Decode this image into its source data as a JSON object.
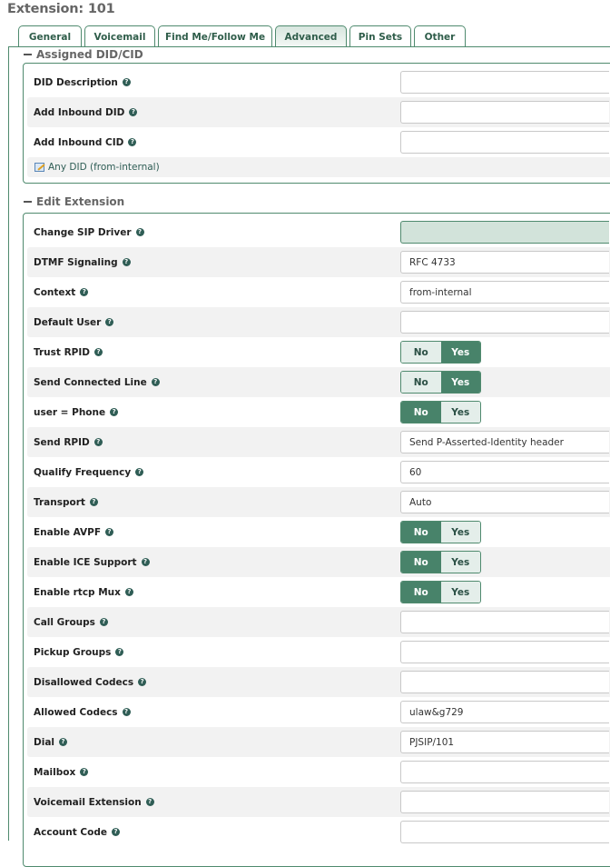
{
  "page": {
    "title": "Extension: 101"
  },
  "tabs": [
    {
      "label": "General",
      "active": false
    },
    {
      "label": "Voicemail",
      "active": false
    },
    {
      "label": "Find Me/Follow Me",
      "active": false
    },
    {
      "label": "Advanced",
      "active": true
    },
    {
      "label": "Pin Sets",
      "active": false
    },
    {
      "label": "Other",
      "active": false
    }
  ],
  "sections": {
    "assigned": {
      "title": "Assigned DID/CID",
      "rows": [
        {
          "label": "DID Description",
          "type": "input",
          "value": ""
        },
        {
          "label": "Add Inbound DID",
          "type": "input",
          "value": ""
        },
        {
          "label": "Add Inbound CID",
          "type": "input",
          "value": ""
        }
      ],
      "link": "Any DID (from-internal)"
    },
    "edit": {
      "title": "Edit Extension",
      "rows": [
        {
          "label": "Change SIP Driver",
          "type": "green",
          "value": ""
        },
        {
          "label": "DTMF Signaling",
          "type": "input",
          "value": "RFC 4733"
        },
        {
          "label": "Context",
          "type": "input",
          "value": "from-internal"
        },
        {
          "label": "Default User",
          "type": "input",
          "value": ""
        },
        {
          "label": "Trust RPID",
          "type": "toggle",
          "value": "Yes"
        },
        {
          "label": "Send Connected Line",
          "type": "toggle",
          "value": "Yes"
        },
        {
          "label": "user = Phone",
          "type": "toggle",
          "value": "No"
        },
        {
          "label": "Send RPID",
          "type": "input",
          "value": "Send P-Asserted-Identity header"
        },
        {
          "label": "Qualify Frequency",
          "type": "input",
          "value": "60"
        },
        {
          "label": "Transport",
          "type": "input",
          "value": "Auto"
        },
        {
          "label": "Enable AVPF",
          "type": "toggle",
          "value": "No"
        },
        {
          "label": "Enable ICE Support",
          "type": "toggle",
          "value": "No"
        },
        {
          "label": "Enable rtcp Mux",
          "type": "toggle",
          "value": "No"
        },
        {
          "label": "Call Groups",
          "type": "input",
          "value": ""
        },
        {
          "label": "Pickup Groups",
          "type": "input",
          "value": ""
        },
        {
          "label": "Disallowed Codecs",
          "type": "input",
          "value": ""
        },
        {
          "label": "Allowed Codecs",
          "type": "input",
          "value": "ulaw&g729"
        },
        {
          "label": "Dial",
          "type": "input",
          "value": "PJSIP/101"
        },
        {
          "label": "Mailbox",
          "type": "input",
          "value": ""
        },
        {
          "label": "Voicemail Extension",
          "type": "input",
          "value": ""
        },
        {
          "label": "Account Code",
          "type": "input",
          "value": ""
        }
      ]
    }
  },
  "toggle_labels": {
    "no": "No",
    "yes": "Yes"
  },
  "icons": {
    "help": "?",
    "collapse": "minus-icon",
    "edit": "edit-icon"
  },
  "colors": {
    "accent": "#48836a",
    "border": "#4f8a6e",
    "toggle_off": "#e4eeea"
  }
}
